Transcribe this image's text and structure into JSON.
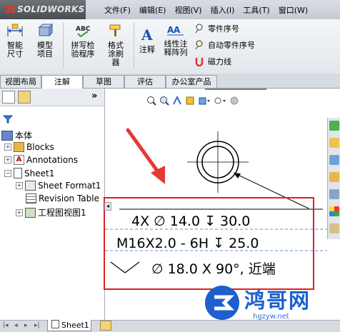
{
  "app": {
    "logo": "SOLIDWORKS"
  },
  "menu": [
    "文件(F)",
    "编辑(E)",
    "视图(V)",
    "插入(I)",
    "工具(T)",
    "窗口(W)"
  ],
  "ribbon": {
    "smart_dim": "智能尺寸",
    "model_items": "模型项目",
    "spell_check": "拼写检验程序",
    "format_painter": "格式涂刷器",
    "note": "注释",
    "linear_note_pattern": "线性注释阵列",
    "balloon": "零件序号",
    "auto_balloon": "自动零件序号",
    "magnetic_line": "磁力线"
  },
  "tabs": [
    "视图布局",
    "注解",
    "草图",
    "评估",
    "办公室产品"
  ],
  "panel": {
    "collapse": "»",
    "tree": {
      "root": "本体",
      "blocks": "Blocks",
      "annotations": "Annotations",
      "sheet1": "Sheet1",
      "sheet_format": "Sheet Format1",
      "revision_table": "Revision Table",
      "drawing_view": "工程图视图1"
    }
  },
  "canvas": {
    "hole_callout": {
      "line1": "4X  ∅ 14.0  ↧  30.0",
      "line2": "M16X2.0 - 6H  ↧  25.0",
      "line3": "∅ 18.0 X 90°, 近端"
    }
  },
  "bottom": {
    "sheet_tab": "Sheet1"
  },
  "watermark": {
    "text": "鸿哥网",
    "url": "hgzyw.net"
  },
  "colors": {
    "highlight_box": "#e02020",
    "arrow": "#e53935",
    "watermark": "#1d5fcf"
  }
}
